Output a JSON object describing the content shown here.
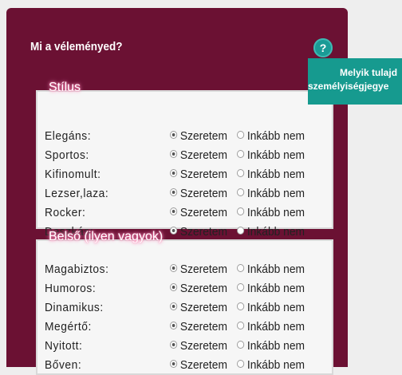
{
  "panel": {
    "title": "Mi a véleményed?",
    "help_symbol": "?",
    "tooltip_line1": "Melyik tulajd",
    "tooltip_line2": "személyiségjegye"
  },
  "groups": [
    {
      "legend": "Stílus",
      "rows": [
        {
          "label": "Elegáns:",
          "opt1": "Szeretem",
          "opt2": "Inkább nem"
        },
        {
          "label": "Sportos:",
          "opt1": "Szeretem",
          "opt2": "Inkább nem"
        },
        {
          "label": "Kifinomult:",
          "opt1": "Szeretem",
          "opt2": "Inkább nem"
        },
        {
          "label": "Lezser,laza:",
          "opt1": "Szeretem",
          "opt2": "Inkább nem"
        },
        {
          "label": "Rocker:",
          "opt1": "Szeretem",
          "opt2": "Inkább nem"
        },
        {
          "label": "Deszkás:",
          "opt1": "Szeretem",
          "opt2": "Inkább nem"
        }
      ]
    },
    {
      "legend": "Belső (ilyen vagyok)",
      "rows": [
        {
          "label": "Magabiztos:",
          "opt1": "Szeretem",
          "opt2": "Inkább nem"
        },
        {
          "label": "Humoros:",
          "opt1": "Szeretem",
          "opt2": "Inkább nem"
        },
        {
          "label": "Dinamikus:",
          "opt1": "Szeretem",
          "opt2": "Inkább nem"
        },
        {
          "label": "Megértő:",
          "opt1": "Szeretem",
          "opt2": "Inkább nem"
        },
        {
          "label": "Nyitott:",
          "opt1": "Szeretem",
          "opt2": "Inkább nem"
        },
        {
          "label": "Bőven:",
          "opt1": "Szeretem",
          "opt2": "Inkább nem"
        }
      ]
    }
  ],
  "selected_option": "Szeretem",
  "colors": {
    "panel": "#6b1133",
    "accent": "#169a8f",
    "legend_glow": "#ff7fb0"
  }
}
